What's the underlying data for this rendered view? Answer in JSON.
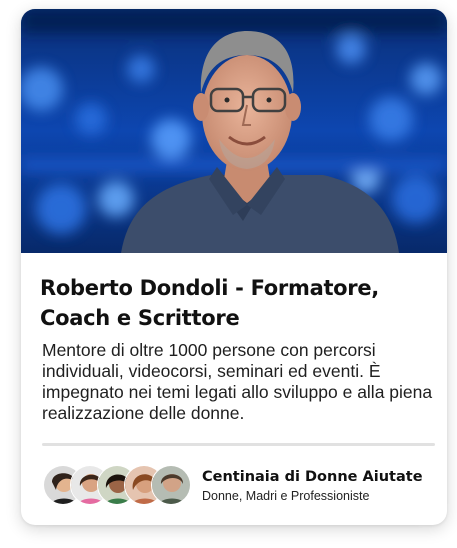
{
  "profile": {
    "name_title": "Roberto Dondoli - Formatore, Coach e Scrittore",
    "description": "Mentore di oltre 1000 persone con percorsi individuali, videocorsi, seminari ed eventi. È impegnato nei temi legati allo sviluppo e alla piena realizzazione delle donne."
  },
  "stats": {
    "title": "Centinaia di Donne Aiutate",
    "subtitle": "Donne, Madri e Professioniste"
  },
  "colors": {
    "background_blue": "#0b3a8f",
    "shirt": "#3c4d6b",
    "text_dark": "#111111"
  }
}
